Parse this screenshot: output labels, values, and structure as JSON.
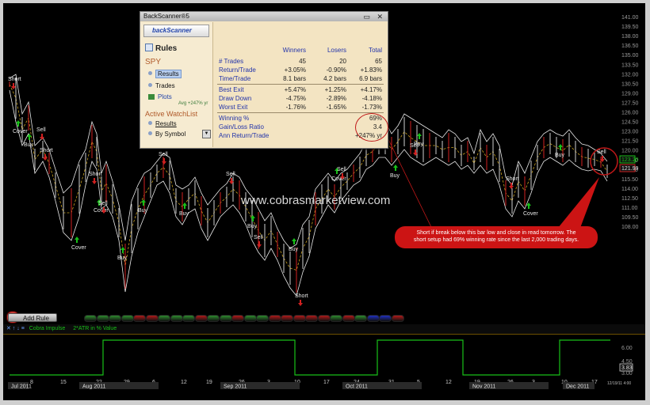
{
  "watermark": "www.cobrasmarketview.com",
  "price_axis": [
    "141.00",
    "139.50",
    "138.00",
    "136.50",
    "135.00",
    "133.50",
    "132.00",
    "130.50",
    "129.00",
    "127.50",
    "126.00",
    "124.50",
    "123.00",
    "121.50",
    "120.00",
    "118.50",
    "117.00",
    "115.50",
    "114.00",
    "112.50",
    "111.00",
    "109.50",
    "108.00"
  ],
  "price_current": "123.20",
  "price_previous": "121.99",
  "backscanner": {
    "title": "BackScanner®5",
    "logo": "backScanner",
    "rules_label": "Rules",
    "symbol": "SPY",
    "options": [
      "Results",
      "Trades"
    ],
    "plots_label": "Plots",
    "avg_label": "Avg +247% yr",
    "active_watchlist_label": "Active WatchList",
    "watchlist_results": "Results",
    "by_symbol": "By Symbol",
    "headers": [
      "Winners",
      "Losers",
      "Total"
    ],
    "rows": [
      {
        "label": "# Trades",
        "w": "45",
        "l": "20",
        "t": "65"
      },
      {
        "label": "Return/Trade",
        "w": "+3.05%",
        "l": "-0.90%",
        "t": "+1.83%"
      },
      {
        "label": "Time/Trade",
        "w": "8.1 bars",
        "l": "4.2 bars",
        "t": "6.9 bars"
      },
      {
        "label": "Best Exit",
        "w": "+5.47%",
        "l": "+1.25%",
        "t": "+4.17%"
      },
      {
        "label": "Draw Down",
        "w": "-4.75%",
        "l": "-2.89%",
        "t": "-4.18%"
      },
      {
        "label": "Worst Exit",
        "w": "-1.76%",
        "l": "-1.65%",
        "t": "-1.73%"
      },
      {
        "label": "Winning %",
        "w": "",
        "l": "",
        "t": "69%"
      },
      {
        "label": "Gain/Loss Ratio",
        "w": "",
        "l": "",
        "t": "3.4"
      },
      {
        "label": "Ann Return/Trade",
        "w": "",
        "l": "",
        "t": "+247% yr"
      }
    ]
  },
  "callout": {
    "line1": "Short if break below this bar low and close in read tomorrow. The",
    "line2": "short setup had 69% winning rate since the last 2,000 trading days."
  },
  "add_rule": "Add Rule",
  "pills": [
    "#2e8b2e",
    "#2e8b2e",
    "#2e8b2e",
    "#2e8b2e",
    "#b01a1a",
    "#b01a1a",
    "#2e8b2e",
    "#2e8b2e",
    "#2e8b2e",
    "#b01a1a",
    "#2e8b2e",
    "#2e8b2e",
    "#b01a1a",
    "#2e8b2e",
    "#2e8b2e",
    "#b01a1a",
    "#b01a1a",
    "#b01a1a",
    "#b01a1a",
    "#b01a1a",
    "#2e8b2e",
    "#b01a1a",
    "#2e8b2e",
    "#2030c0",
    "#2030c0",
    "#b01a1a"
  ],
  "indicator": {
    "name": "Cobra Impulse",
    "param": "2*ATR in % Value",
    "axis": [
      "6.00",
      "4.50",
      "3.00"
    ],
    "value": "3.83",
    "line_color": "#18c018"
  },
  "signals": [
    {
      "text": "Short",
      "type": "short"
    },
    {
      "text": "Cover",
      "type": "cover"
    },
    {
      "text": "Sell",
      "type": "sell"
    },
    {
      "text": "Buy",
      "type": "buy"
    },
    {
      "text": "Short",
      "type": "short"
    },
    {
      "text": "Cover",
      "type": "cover"
    },
    {
      "text": "Short",
      "type": "short"
    },
    {
      "text": "Cover",
      "type": "cover"
    },
    {
      "text": "Sell",
      "type": "sell"
    },
    {
      "text": "Buy",
      "type": "buy"
    },
    {
      "text": "Buy",
      "type": "buy"
    },
    {
      "text": "Sell",
      "type": "sell"
    },
    {
      "text": "Buy",
      "type": "buy"
    },
    {
      "text": "Sell",
      "type": "sell"
    },
    {
      "text": "Buy",
      "type": "buy"
    },
    {
      "text": "Sell",
      "type": "sell"
    },
    {
      "text": "Buy",
      "type": "buy"
    },
    {
      "text": "Short",
      "type": "short"
    },
    {
      "text": "Cover",
      "type": "cover"
    },
    {
      "text": "Sell",
      "type": "sell"
    },
    {
      "text": "Buy",
      "type": "buy"
    },
    {
      "text": "Sell",
      "type": "sell"
    },
    {
      "text": "Buy",
      "type": "buy"
    },
    {
      "text": "Short",
      "type": "short"
    },
    {
      "text": "Cover",
      "type": "cover"
    },
    {
      "text": "Buy",
      "type": "buy"
    },
    {
      "text": "Sell",
      "type": "sell"
    }
  ],
  "dates": [
    "Jul 2011",
    "8",
    "15",
    "22",
    "29",
    "Aug 2011",
    "6",
    "12",
    "19",
    "26",
    "Sep 2011",
    "3",
    "10",
    "17",
    "24",
    "31",
    "Oct 2011",
    "5",
    "12",
    "19",
    "26",
    "Nov 2011",
    "3",
    "10",
    "17",
    "24",
    "Dec 2011",
    "1",
    "5",
    "12"
  ],
  "date_ticks": [
    "8",
    "15",
    "22",
    "29",
    "6",
    "12",
    "19",
    "26",
    "3",
    "10",
    "17",
    "24",
    "31",
    "5",
    "12",
    "19",
    "26",
    "3",
    "10",
    "17",
    "24",
    "1",
    "5",
    "12"
  ],
  "months": [
    "Jul 2011",
    "Aug 2011",
    "Sep 2011",
    "Oct 2011",
    "Nov 2011",
    "Dec 2011"
  ],
  "corner_time": "12/19/11 4:00"
}
